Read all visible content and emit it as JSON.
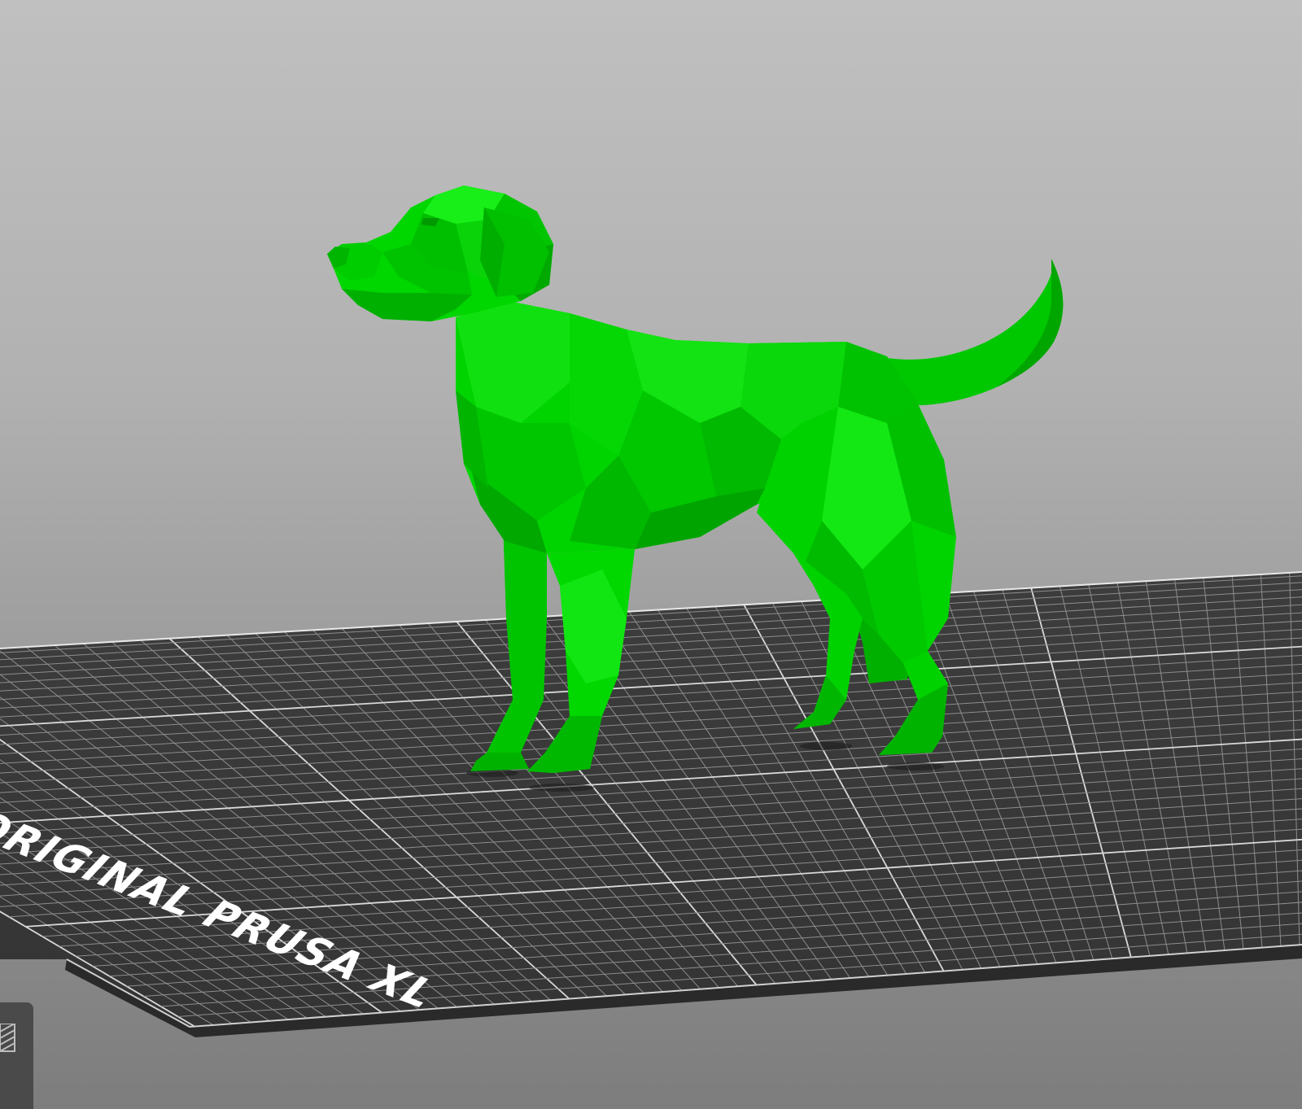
{
  "viewport": {
    "background": "#b4b4b4",
    "bed": {
      "label": "ORIGINAL PRUSA XL",
      "surface_color": "#3a3a3a",
      "grid_color": "#8d8d8d",
      "major_line_color": "#d9d9d9"
    },
    "model": {
      "name": "low-poly dog",
      "color": "#00d000",
      "color_dark": "#00a600",
      "color_light": "#16ef16",
      "selected": true
    }
  },
  "toolbar": {
    "view_toggle_icon": "layers-icon"
  }
}
